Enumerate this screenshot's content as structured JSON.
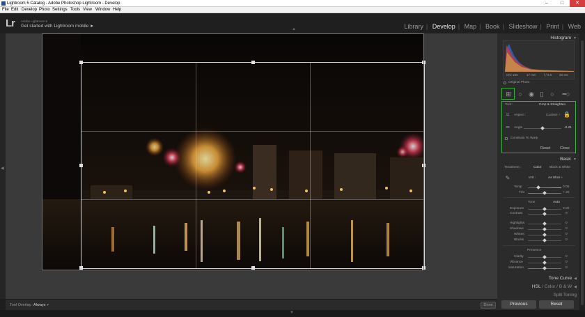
{
  "window": {
    "title": "Lightroom 5 Catalog - Adobe Photoshop Lightroom - Develop",
    "controls": {
      "minimize": "–",
      "maximize": "□",
      "close": "✕"
    }
  },
  "menu": [
    "File",
    "Edit",
    "Develop",
    "Photo",
    "Settings",
    "Tools",
    "View",
    "Window",
    "Help"
  ],
  "identity": {
    "logo": "Lr",
    "product": "Adobe Lightroom 5",
    "tagline": "Get started with Lightroom mobile ►"
  },
  "modules": [
    "Library",
    "Develop",
    "Map",
    "Book",
    "Slideshow",
    "Print",
    "Web"
  ],
  "active_module": "Develop",
  "toolbar": {
    "overlay_label": "Tool Overlay :",
    "overlay_value": "Always ÷",
    "done_label": "Done"
  },
  "histogram": {
    "title": "Histogram",
    "iso": "ISO 100",
    "focal": "17 mm",
    "aperture": "f / 6.0",
    "shutter": "30 sec",
    "original_photo": "Original Photo"
  },
  "crop_panel": {
    "tool_label": "Tool :",
    "tool_value": "Crop & Straighten",
    "aspect_label": "Aspect :",
    "aspect_value": "Custom ÷",
    "angle_label": "Angle",
    "angle_value": "-0.21",
    "constrain_label": "Constrain To Warp",
    "reset_label": "Reset",
    "close_label": "Close"
  },
  "basic": {
    "title": "Basic",
    "treatment_label": "Treatment :",
    "color_label": "Color",
    "bw_label": "Black & White",
    "wb_label": "WB :",
    "wb_value": "As Shot ÷",
    "temp_label": "Temp",
    "temp_value": "0.00",
    "tint_label": "Tint",
    "tint_value": "+ 20",
    "tone_label": "Tone",
    "tone_auto": "Auto",
    "tone_sliders": [
      {
        "label": "Exposure",
        "value": "0.00"
      },
      {
        "label": "Contrast",
        "value": "0"
      },
      {
        "label": "Highlights",
        "value": "0"
      },
      {
        "label": "Shadows",
        "value": "0"
      },
      {
        "label": "Whites",
        "value": "0"
      },
      {
        "label": "Blacks",
        "value": "0"
      }
    ],
    "presence_label": "Presence",
    "presence_sliders": [
      {
        "label": "Clarity",
        "value": "0"
      },
      {
        "label": "Vibrance",
        "value": "0"
      },
      {
        "label": "Saturation",
        "value": "0"
      }
    ]
  },
  "tone_curve": {
    "title": "Tone Curve"
  },
  "hsl": {
    "hsl": "HSL",
    "color": "Color",
    "bw": "B & W"
  },
  "split_toning": {
    "title": "Split Toning"
  },
  "buttons": {
    "previous": "Previous",
    "reset": "Reset"
  },
  "colors": {
    "selection_green": "#35b23b",
    "panel_bg": "#2b2b2b",
    "canvas_bg": "#3a3a3a"
  }
}
